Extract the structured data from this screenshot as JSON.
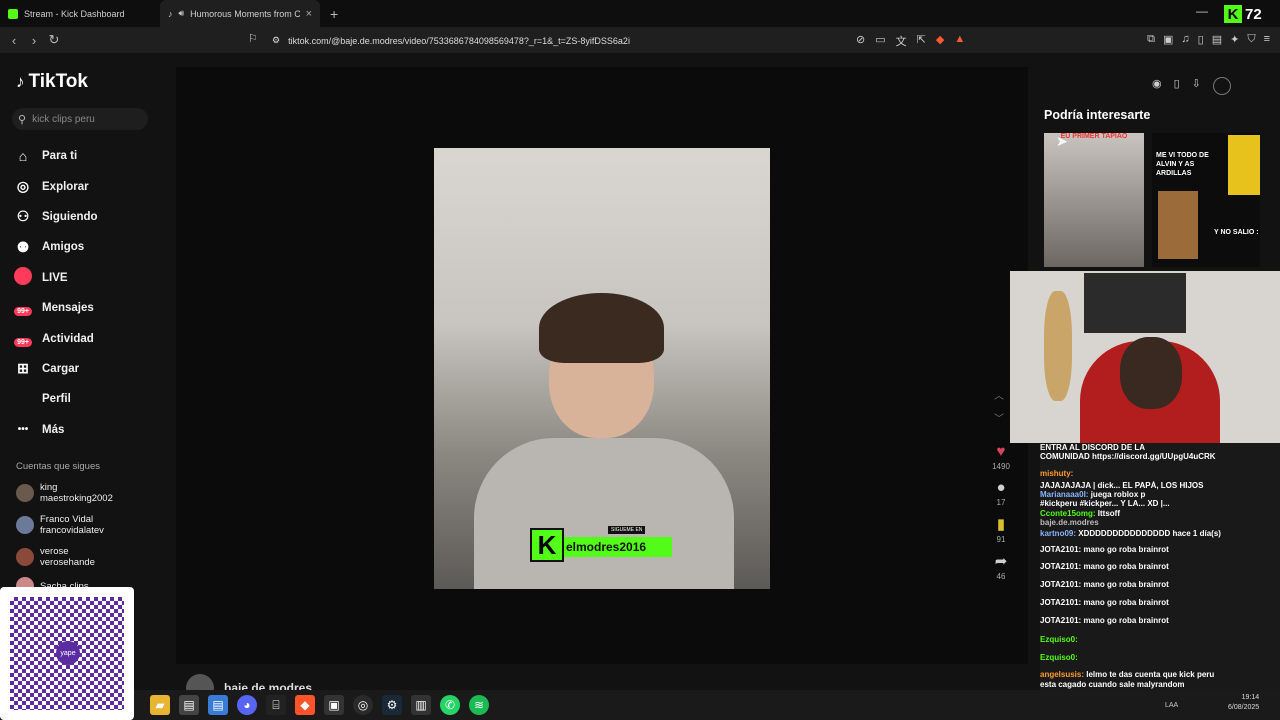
{
  "browser": {
    "tabs": [
      {
        "label": "Stream - Kick Dashboard",
        "color": "#53fc18"
      },
      {
        "label": "Humorous Moments from C",
        "color": "#ffffff"
      }
    ],
    "new_tab": "+",
    "url": "tiktok.com/@baje.de.modres/video/7533686784098569478?_r=1&_t=ZS-8yifDSS6a2i",
    "kick_count": "72"
  },
  "sidebar": {
    "brand": "TikTok",
    "search_placeholder": "kick clips peru",
    "items": [
      {
        "icon": "home-icon",
        "glyph": "⌂",
        "label": "Para ti"
      },
      {
        "icon": "compass-icon",
        "glyph": "◎",
        "label": "Explorar"
      },
      {
        "icon": "following-icon",
        "glyph": "⚇",
        "label": "Siguiendo"
      },
      {
        "icon": "friends-icon",
        "glyph": "⚉",
        "label": "Amigos"
      },
      {
        "icon": "live-icon",
        "glyph": "",
        "label": "LIVE"
      },
      {
        "icon": "messages-icon",
        "badge": "99+",
        "label": "Mensajes"
      },
      {
        "icon": "activity-icon",
        "badge": "99+",
        "label": "Actividad"
      },
      {
        "icon": "upload-icon",
        "glyph": "⊞",
        "label": "Cargar"
      },
      {
        "icon": "profile-icon",
        "glyph": "",
        "label": "Perfil"
      },
      {
        "icon": "more-icon",
        "glyph": "•••",
        "label": "Más"
      }
    ],
    "following_header": "Cuentas que sigues",
    "following": [
      {
        "name": "king",
        "handle": "maestroking2002"
      },
      {
        "name": "Franco Vidal",
        "handle": "francovidalatev"
      },
      {
        "name": "verose",
        "handle": "verosehande"
      },
      {
        "name": "Sacha clips",
        "handle": ""
      }
    ]
  },
  "video": {
    "overlay_small": "SIGUEME EN",
    "overlay_name": "elmodres2016",
    "channel": "baje.de.modres"
  },
  "actions": {
    "likes": "1490",
    "comments": "17",
    "saves": "91",
    "shares": "46"
  },
  "recommend": {
    "header": "Podría interesarte",
    "thumb1_title": "EU PRIMER TAPIAO",
    "thumb2_text1": "ME VI TODO DE ALVIN Y AS ARDILLAS",
    "thumb2_text2": "Y NO SALIO :"
  },
  "chat": [
    {
      "user": "",
      "msg": "ENTRA AL DISCORD DE LA",
      "color": "#ffffff"
    },
    {
      "user": "",
      "msg": "COMUNIDAD https://discord.gg/UUpgU4uCRK",
      "color": "#ffffff"
    },
    {
      "user": "mishuty:",
      "msg": "",
      "color": "#ff9a2e"
    },
    {
      "user": "",
      "msg": "JAJAJAJAJA | dick...   EL PAPÁ, LOS HIJOS",
      "color": "#ffffff"
    },
    {
      "user": "Marianaaa0l:",
      "msg": "juega roblox p",
      "color": "#8ab4ff"
    },
    {
      "user": "",
      "msg": "#kickperu #kickper...   Y LA... XD |...",
      "color": "#ffffff"
    },
    {
      "user": "Cconte15omg:",
      "msg": "Ittsoff",
      "color": "#53fc18"
    },
    {
      "user": "",
      "msg": "baje.de.modres",
      "color": "#bbbbbb"
    },
    {
      "user": "kartno09:",
      "msg": "XDDDDDDDDDDDDDDD   hace 1 día(s)",
      "color": "#8ab4ff"
    },
    {
      "user": "JOTA2101:",
      "msg": "mano go roba brainrot",
      "color": "#ffffff"
    },
    {
      "user": "JOTA2101:",
      "msg": "mano go roba brainrot",
      "color": "#ffffff"
    },
    {
      "user": "JOTA2101:",
      "msg": "mano go roba brainrot",
      "color": "#ffffff"
    },
    {
      "user": "JOTA2101:",
      "msg": "mano go roba brainrot",
      "color": "#ffffff"
    },
    {
      "user": "JOTA2101:",
      "msg": "mano go roba brainrot",
      "color": "#ffffff"
    },
    {
      "user": "Ezquiso0:",
      "msg": "",
      "color": "#53fc18"
    },
    {
      "user": "Ezquiso0:",
      "msg": "",
      "color": "#53fc18"
    },
    {
      "user": "angelsusis:",
      "msg": "lelmo te das cuenta que kick peru",
      "color": "#ff9a2e"
    },
    {
      "user": "",
      "msg": "esta cagado cuando sale malyrandom",
      "color": "#ffffff"
    }
  ],
  "taskbar": {
    "time": "19:14",
    "date": "6/08/2025",
    "lang": "LAA"
  },
  "qr": {
    "label": "yape"
  }
}
